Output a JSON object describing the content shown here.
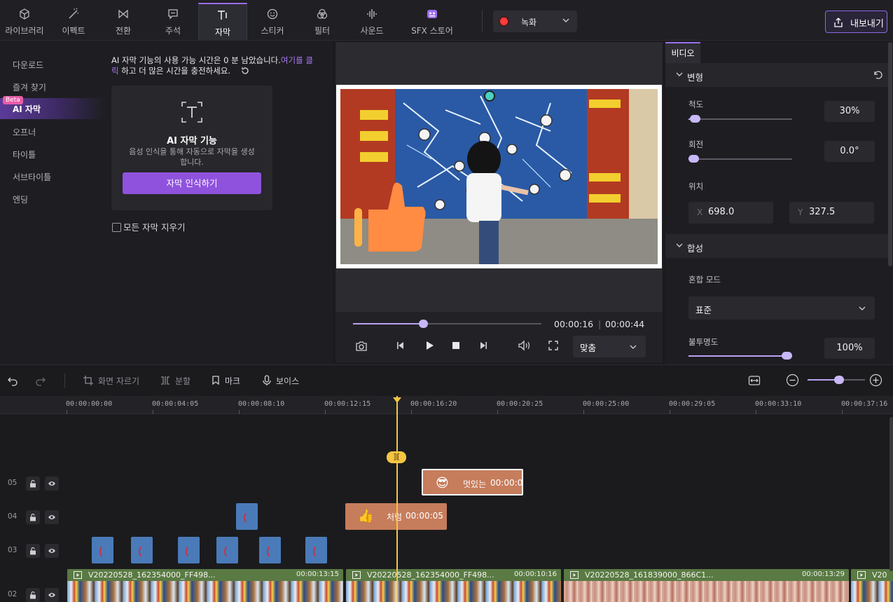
{
  "toolbar": {
    "tabs": [
      {
        "label": "라이브러리",
        "icon": "cube-icon"
      },
      {
        "label": "이펙트",
        "icon": "magic-wand-icon"
      },
      {
        "label": "전환",
        "icon": "transition-icon"
      },
      {
        "label": "주석",
        "icon": "comment-icon"
      },
      {
        "label": "자막",
        "icon": "text-icon",
        "active": true
      },
      {
        "label": "스티커",
        "icon": "smiley-icon"
      },
      {
        "label": "필터",
        "icon": "filter-icon"
      },
      {
        "label": "사운드",
        "icon": "waveform-icon"
      },
      {
        "label": "SFX 스토어",
        "icon": "store-icon"
      }
    ],
    "record_label": "녹화",
    "export_label": "내보내기",
    "accent": "#9b6ff0"
  },
  "sidebar": {
    "items": [
      "다운로드",
      "즐겨 찾기",
      "AI 자막",
      "오프너",
      "타이틀",
      "서브타이틀",
      "엔딩"
    ],
    "active_index": 2,
    "beta_badge": "Beta"
  },
  "subtitle_panel": {
    "notice_text": "AI 자막 기능의 사용 가능 시간은 0 분 남았습니다.",
    "notice_link": "여기를 클릭",
    "notice_suffix": " 하고 더 많은 시간을 충전하세요.",
    "card_title": "AI 자막 기능",
    "card_desc": "음성 인식을 통해 자동으로 자막을 생성합니다.",
    "button_label": "자막 인식하기",
    "checkbox_label": "모든 자막 지우기",
    "checkbox_checked": false
  },
  "preview": {
    "current_time": "00:00:16",
    "total_time": "00:00:44",
    "progress": 0.37,
    "fit_label": "맞춤"
  },
  "properties": {
    "tab_label": "비디오",
    "transform_title": "변형",
    "scale_label": "척도",
    "scale_value": "30%",
    "scale_level": 0.06,
    "rotate_label": "회전",
    "rotate_value": "0.0°",
    "rotate_level": 0.0,
    "position_label": "위치",
    "pos_x_key": "X",
    "pos_x": "698.0",
    "pos_y_key": "Y",
    "pos_y": "327.5",
    "composite_title": "합성",
    "blend_label": "혼합 모드",
    "blend_value": "표준",
    "opacity_label": "불투명도",
    "opacity_value": "100%",
    "opacity_level": 1.0
  },
  "timeline_toolbar": {
    "crop_label": "화면 자르기",
    "split_label": "분할",
    "mark_label": "마크",
    "voice_label": "보이스",
    "zoom_level": 0.55
  },
  "timeline": {
    "ticks": [
      "00:00:00:00",
      "00:00:04:05",
      "00:00:08:10",
      "00:00:12:15",
      "00:00:16:20",
      "00:00:20:25",
      "00:00:25:00",
      "00:00:29:05",
      "00:00:33:10",
      "00:00:37:16"
    ],
    "split_badge": "⟧⟦",
    "tracks": [
      "05",
      "04",
      "03",
      "02"
    ],
    "sticker_05": {
      "emoji": "😎",
      "name": "멋있는",
      "duration": "00:00:0"
    },
    "sticker_04": {
      "emoji": "👍",
      "name": "처럼",
      "duration": "00:00:05"
    },
    "video_clips": [
      {
        "name": "V20220528_162354000_FF498...",
        "duration": "00:00:13:15"
      },
      {
        "name": "V20220528_162354000_FF498...",
        "duration": "00:00:10:16"
      },
      {
        "name": "V20220528_161839000_866C1...",
        "duration": "00:00:13:29"
      },
      {
        "name": "V20",
        "duration": ""
      }
    ]
  }
}
